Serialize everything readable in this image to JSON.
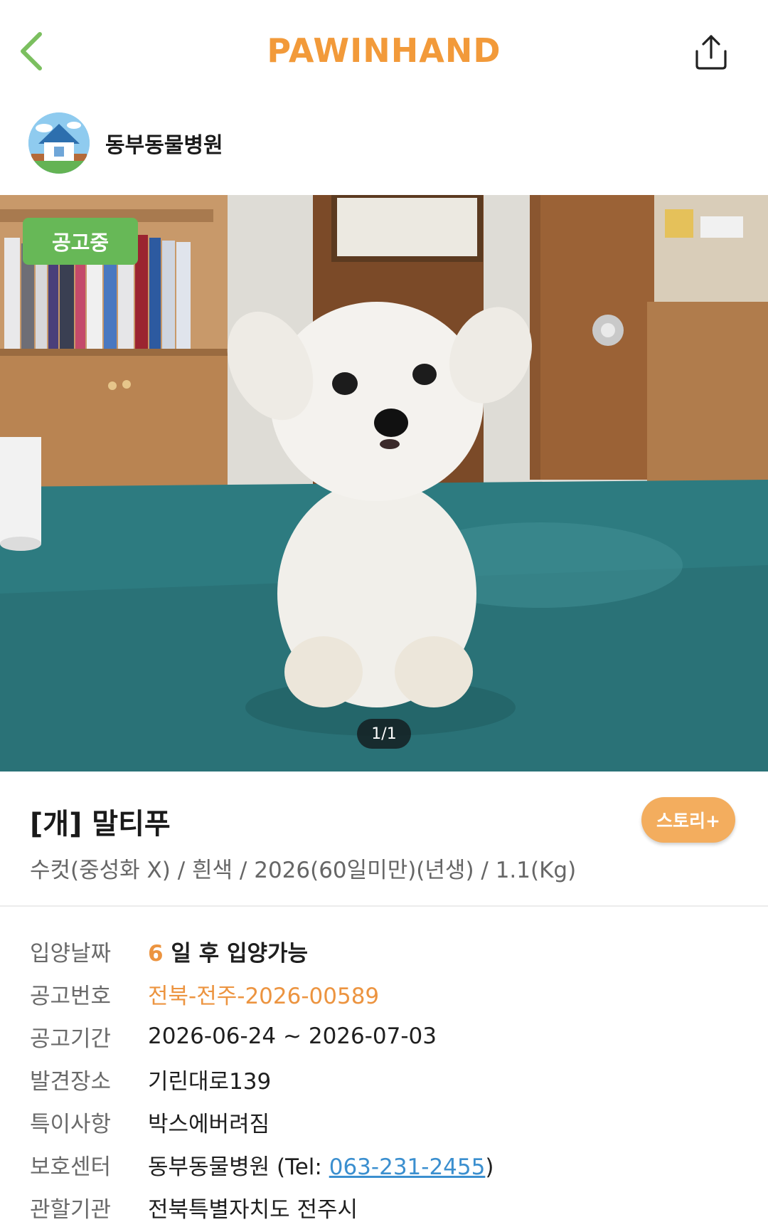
{
  "header": {
    "logo": "PAWINHAND",
    "back_icon": "chevron-left-icon",
    "share_icon": "share-icon",
    "accent_color": "#f29a3a"
  },
  "shelter": {
    "name": "동부동물병원",
    "avatar_icon": "house-icon"
  },
  "photo": {
    "status_badge": "공고중",
    "counter": "1/1"
  },
  "animal": {
    "title": "[개] 말티푸",
    "summary": "수컷(중성화 X) / 흰색 / 2026(60일미만)(년생) / 1.1(Kg)",
    "story_button": "스토리+"
  },
  "info": {
    "adopt_date": {
      "label": "입양날짜",
      "days": "6",
      "suffix": " 일 후 입양가능"
    },
    "notice_no": {
      "label": "공고번호",
      "value": "전북-전주-2026-00589"
    },
    "notice_period": {
      "label": "공고기간",
      "value": "2026-06-24 ~ 2026-07-03"
    },
    "found_place": {
      "label": "발견장소",
      "value": "기린대로139"
    },
    "special": {
      "label": "특이사항",
      "value": "박스에버려짐"
    },
    "center": {
      "label": "보호센터",
      "name": "동부동물병원 (Tel: ",
      "tel": "063-231-2455",
      "close": ")"
    },
    "authority": {
      "label": "관할기관",
      "value": "전북특별자치도 전주시"
    }
  }
}
